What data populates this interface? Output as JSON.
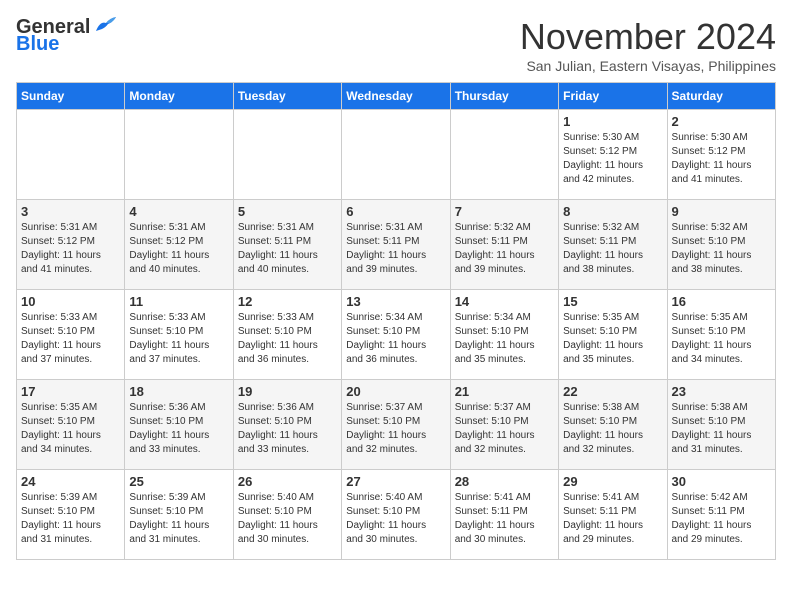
{
  "header": {
    "logo_general": "General",
    "logo_blue": "Blue",
    "month_title": "November 2024",
    "location": "San Julian, Eastern Visayas, Philippines"
  },
  "weekdays": [
    "Sunday",
    "Monday",
    "Tuesday",
    "Wednesday",
    "Thursday",
    "Friday",
    "Saturday"
  ],
  "weeks": [
    [
      {
        "day": "",
        "info": ""
      },
      {
        "day": "",
        "info": ""
      },
      {
        "day": "",
        "info": ""
      },
      {
        "day": "",
        "info": ""
      },
      {
        "day": "",
        "info": ""
      },
      {
        "day": "1",
        "info": "Sunrise: 5:30 AM\nSunset: 5:12 PM\nDaylight: 11 hours\nand 42 minutes."
      },
      {
        "day": "2",
        "info": "Sunrise: 5:30 AM\nSunset: 5:12 PM\nDaylight: 11 hours\nand 41 minutes."
      }
    ],
    [
      {
        "day": "3",
        "info": "Sunrise: 5:31 AM\nSunset: 5:12 PM\nDaylight: 11 hours\nand 41 minutes."
      },
      {
        "day": "4",
        "info": "Sunrise: 5:31 AM\nSunset: 5:12 PM\nDaylight: 11 hours\nand 40 minutes."
      },
      {
        "day": "5",
        "info": "Sunrise: 5:31 AM\nSunset: 5:11 PM\nDaylight: 11 hours\nand 40 minutes."
      },
      {
        "day": "6",
        "info": "Sunrise: 5:31 AM\nSunset: 5:11 PM\nDaylight: 11 hours\nand 39 minutes."
      },
      {
        "day": "7",
        "info": "Sunrise: 5:32 AM\nSunset: 5:11 PM\nDaylight: 11 hours\nand 39 minutes."
      },
      {
        "day": "8",
        "info": "Sunrise: 5:32 AM\nSunset: 5:11 PM\nDaylight: 11 hours\nand 38 minutes."
      },
      {
        "day": "9",
        "info": "Sunrise: 5:32 AM\nSunset: 5:10 PM\nDaylight: 11 hours\nand 38 minutes."
      }
    ],
    [
      {
        "day": "10",
        "info": "Sunrise: 5:33 AM\nSunset: 5:10 PM\nDaylight: 11 hours\nand 37 minutes."
      },
      {
        "day": "11",
        "info": "Sunrise: 5:33 AM\nSunset: 5:10 PM\nDaylight: 11 hours\nand 37 minutes."
      },
      {
        "day": "12",
        "info": "Sunrise: 5:33 AM\nSunset: 5:10 PM\nDaylight: 11 hours\nand 36 minutes."
      },
      {
        "day": "13",
        "info": "Sunrise: 5:34 AM\nSunset: 5:10 PM\nDaylight: 11 hours\nand 36 minutes."
      },
      {
        "day": "14",
        "info": "Sunrise: 5:34 AM\nSunset: 5:10 PM\nDaylight: 11 hours\nand 35 minutes."
      },
      {
        "day": "15",
        "info": "Sunrise: 5:35 AM\nSunset: 5:10 PM\nDaylight: 11 hours\nand 35 minutes."
      },
      {
        "day": "16",
        "info": "Sunrise: 5:35 AM\nSunset: 5:10 PM\nDaylight: 11 hours\nand 34 minutes."
      }
    ],
    [
      {
        "day": "17",
        "info": "Sunrise: 5:35 AM\nSunset: 5:10 PM\nDaylight: 11 hours\nand 34 minutes."
      },
      {
        "day": "18",
        "info": "Sunrise: 5:36 AM\nSunset: 5:10 PM\nDaylight: 11 hours\nand 33 minutes."
      },
      {
        "day": "19",
        "info": "Sunrise: 5:36 AM\nSunset: 5:10 PM\nDaylight: 11 hours\nand 33 minutes."
      },
      {
        "day": "20",
        "info": "Sunrise: 5:37 AM\nSunset: 5:10 PM\nDaylight: 11 hours\nand 32 minutes."
      },
      {
        "day": "21",
        "info": "Sunrise: 5:37 AM\nSunset: 5:10 PM\nDaylight: 11 hours\nand 32 minutes."
      },
      {
        "day": "22",
        "info": "Sunrise: 5:38 AM\nSunset: 5:10 PM\nDaylight: 11 hours\nand 32 minutes."
      },
      {
        "day": "23",
        "info": "Sunrise: 5:38 AM\nSunset: 5:10 PM\nDaylight: 11 hours\nand 31 minutes."
      }
    ],
    [
      {
        "day": "24",
        "info": "Sunrise: 5:39 AM\nSunset: 5:10 PM\nDaylight: 11 hours\nand 31 minutes."
      },
      {
        "day": "25",
        "info": "Sunrise: 5:39 AM\nSunset: 5:10 PM\nDaylight: 11 hours\nand 31 minutes."
      },
      {
        "day": "26",
        "info": "Sunrise: 5:40 AM\nSunset: 5:10 PM\nDaylight: 11 hours\nand 30 minutes."
      },
      {
        "day": "27",
        "info": "Sunrise: 5:40 AM\nSunset: 5:10 PM\nDaylight: 11 hours\nand 30 minutes."
      },
      {
        "day": "28",
        "info": "Sunrise: 5:41 AM\nSunset: 5:11 PM\nDaylight: 11 hours\nand 30 minutes."
      },
      {
        "day": "29",
        "info": "Sunrise: 5:41 AM\nSunset: 5:11 PM\nDaylight: 11 hours\nand 29 minutes."
      },
      {
        "day": "30",
        "info": "Sunrise: 5:42 AM\nSunset: 5:11 PM\nDaylight: 11 hours\nand 29 minutes."
      }
    ]
  ]
}
